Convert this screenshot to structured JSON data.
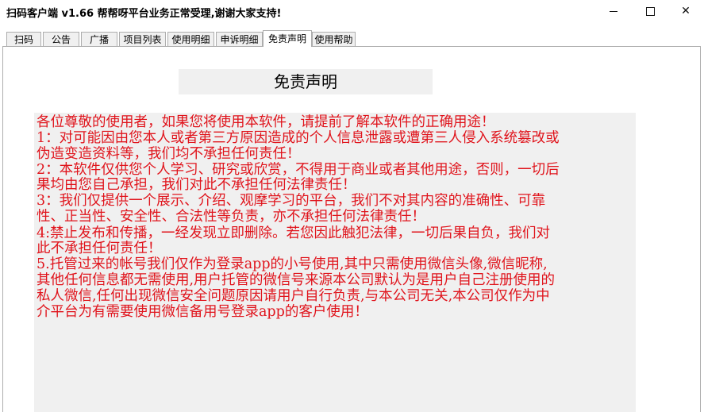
{
  "window": {
    "title": "扫码客户端 v1.66     帮帮呀平台业务正常受理,谢谢大家支持!",
    "minimize_glyph": "minimize-icon",
    "maximize_glyph": "maximize-icon",
    "close_glyph": "✕"
  },
  "tabs": [
    {
      "label": "扫码",
      "active": false
    },
    {
      "label": "公告",
      "active": false
    },
    {
      "label": "广播",
      "active": false
    },
    {
      "label": "项目列表",
      "active": false
    },
    {
      "label": "使用明细",
      "active": false
    },
    {
      "label": "申诉明细",
      "active": false
    },
    {
      "label": "免责声明",
      "active": true
    },
    {
      "label": "使用帮助",
      "active": false
    }
  ],
  "main": {
    "heading": "免责声明",
    "lines": [
      "各位尊敬的使用者，如果您将使用本软件，请提前了解本软件的正确用途！",
      "1：对可能因由您本人或者第三方原因造成的个人信息泄露或遭第三人侵入系统篡改或",
      "伪造变造资料等，我们均不承担任何责任！",
      "2：本软件仅供您个人学习、研究或欣赏，不得用于商业或者其他用途，否则，一切后",
      "果均由您自己承担，我们对此不承担任何法律责任！",
      "3：我们仅提供一个展示、介绍、观摩学习的平台，我们不对其内容的准确性、可靠",
      "性、正当性、安全性、合法性等负责，亦不承担任何法律责任！",
      "4:禁止发布和传播，一经发现立即删除。若您因此触犯法律，一切后果自负，我们对",
      "此不承担任何责任！",
      "5.托管过来的帐号我们仅作为登录app的小号使用,其中只需使用微信头像,微信昵称,",
      "其他任何信息都无需使用,用户托管的微信号来源本公司默认为是用户自己注册使用的",
      "私人微信,任何出现微信安全问题原因请用户自行负责,与本公司无关,本公司仅作为中",
      "介平台为有需要使用微信备用号登录app的客户使用！"
    ],
    "text_color": "#e0141c"
  }
}
